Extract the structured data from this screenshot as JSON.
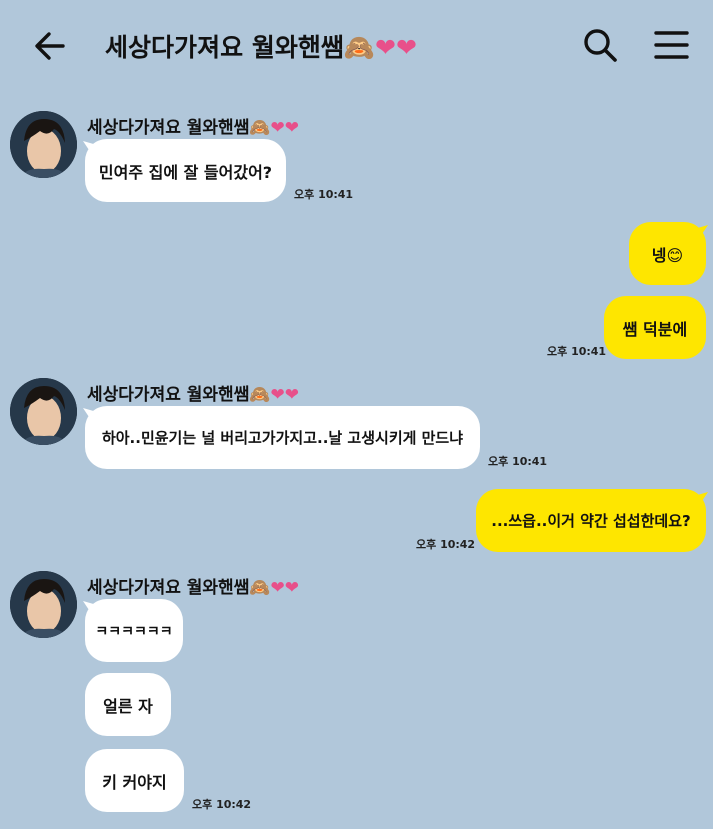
{
  "header": {
    "title": "세상다가져요 월와핸쌤🙈❤❤"
  },
  "messages": [
    {
      "sender": "세상다가져요 월와핸쌤🙈❤❤",
      "text": "민여주 집에 잘 들어갔어?",
      "time": "오후 10:41"
    },
    {
      "text": "넹😊"
    },
    {
      "text": "쌤 덕분에",
      "time": "오후 10:41"
    },
    {
      "sender": "세상다가져요 월와핸쌤🙈❤❤",
      "text": "하아..민윤기는 널 버리고가가지고..날 고생시키게 만드냐",
      "time": "오후 10:41"
    },
    {
      "text": "...쓰읍..이거 약간 섭섭한데요?",
      "time": "오후 10:42"
    },
    {
      "sender": "세상다가져요 월와핸쌤🙈❤❤",
      "text": "ㅋㅋㅋㅋㅋㅋ"
    },
    {
      "text": "얼른 자"
    },
    {
      "text": "키 커야지",
      "time": "오후 10:42"
    }
  ],
  "colors": {
    "background": "#b1c7da",
    "outgoing_bubble": "#fee600",
    "incoming_bubble": "#ffffff",
    "heart": "#e8508a"
  },
  "icons": {
    "back": "arrow-left-icon",
    "search": "search-icon",
    "menu": "hamburger-menu-icon"
  }
}
